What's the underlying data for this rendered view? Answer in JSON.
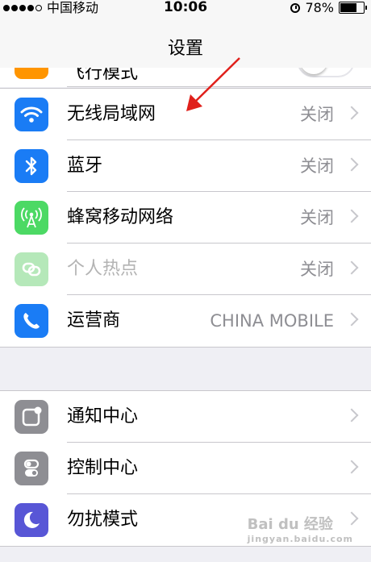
{
  "status_bar": {
    "carrier": "中国移动",
    "time": "10:06",
    "battery_percent": "78%",
    "battery_level": 0.78
  },
  "nav": {
    "title": "设置"
  },
  "partial_row": {
    "label": "飞行模式"
  },
  "group1": [
    {
      "label": "无线局域网",
      "value": "关闭",
      "icon": "wifi-icon",
      "color": "#1a7cf5"
    },
    {
      "label": "蓝牙",
      "value": "关闭",
      "icon": "bluetooth-icon",
      "color": "#1a7cf5"
    },
    {
      "label": "蜂窝移动网络",
      "value": "关闭",
      "icon": "cellular-antenna-icon",
      "color": "#4cd964"
    },
    {
      "label": "个人热点",
      "value": "关闭",
      "icon": "hotspot-link-icon",
      "color": "#b5e8b9",
      "disabled": true
    },
    {
      "label": "运营商",
      "value": "CHINA MOBILE",
      "icon": "phone-icon",
      "color": "#1a7cf5"
    }
  ],
  "group2": [
    {
      "label": "通知中心",
      "icon": "notification-center-icon",
      "color": "#8e8e93"
    },
    {
      "label": "控制中心",
      "icon": "control-center-icon",
      "color": "#8e8e93"
    },
    {
      "label": "勿扰模式",
      "icon": "moon-icon",
      "color": "#5856d6"
    }
  ],
  "watermark": {
    "text": "Bai du 经验",
    "subtext": "jingyan.baidu.com"
  }
}
